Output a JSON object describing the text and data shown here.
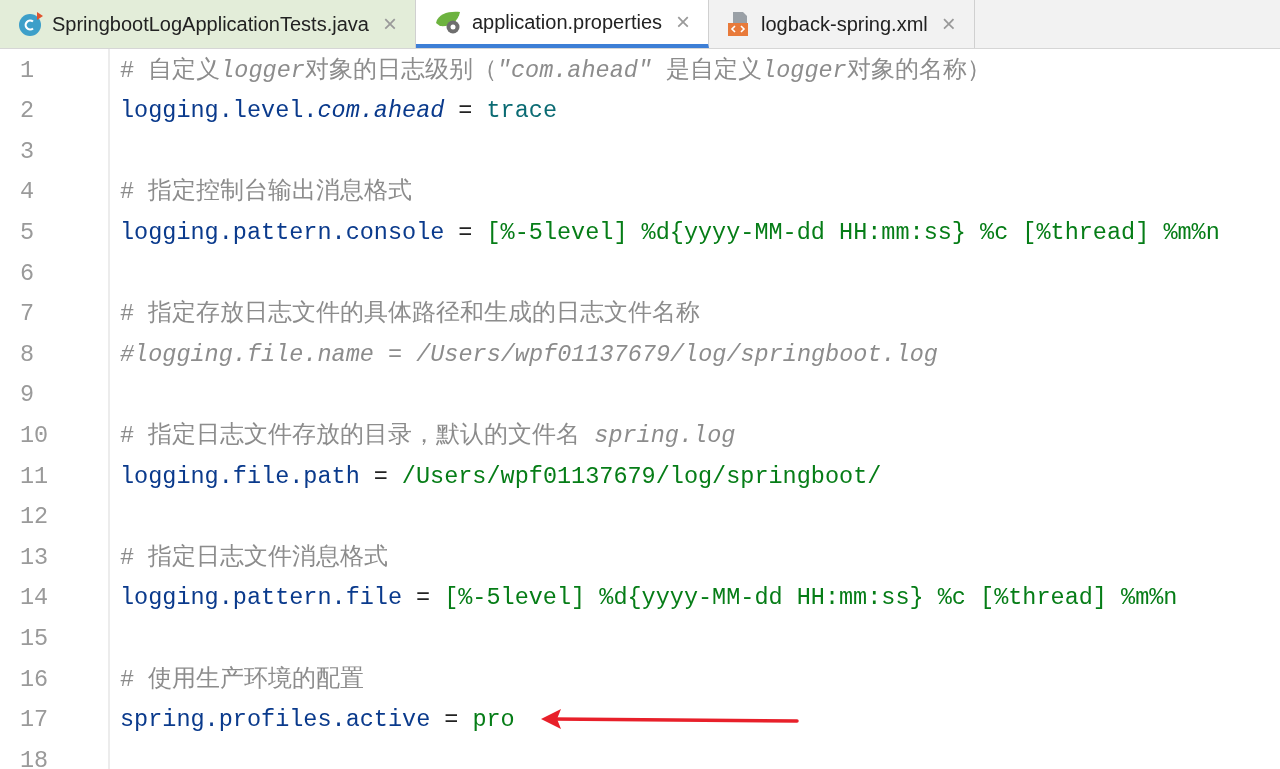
{
  "tabs": [
    {
      "label": "SpringbootLogApplicationTests.java",
      "kind": "java",
      "selected": false,
      "close": "×"
    },
    {
      "label": "application.properties",
      "kind": "properties",
      "selected": true,
      "close": "×"
    },
    {
      "label": "logback-spring.xml",
      "kind": "xml",
      "selected": false,
      "close": "×"
    }
  ],
  "lines": [
    {
      "number": "1",
      "kind": "comment",
      "parts": [
        {
          "text": "# 自定义",
          "italic": false
        },
        {
          "text": "logger",
          "italic": true
        },
        {
          "text": "对象的日志级别（",
          "italic": false
        },
        {
          "text": "\"com.ahead\"",
          "italic": true
        },
        {
          "text": " 是自定义",
          "italic": false
        },
        {
          "text": "logger",
          "italic": true
        },
        {
          "text": "对象的名称）",
          "italic": false
        }
      ]
    },
    {
      "number": "2",
      "kind": "property",
      "key": "logging.level.*com.ahead*",
      "sep": "=",
      "value": {
        "text": "trace",
        "kind": "constant"
      }
    },
    {
      "number": "3",
      "kind": "blank"
    },
    {
      "number": "4",
      "kind": "comment",
      "parts": [
        {
          "text": "# 指定控制台输出消息格式",
          "italic": false
        }
      ]
    },
    {
      "number": "5",
      "kind": "property",
      "key": "logging.pattern.console",
      "sep": "=",
      "value": {
        "text": "[%-5level] %d{yyyy-MM-dd HH:mm:ss} %c [%thread] %m%n",
        "kind": "string"
      }
    },
    {
      "number": "6",
      "kind": "blank"
    },
    {
      "number": "7",
      "kind": "comment",
      "parts": [
        {
          "text": "# 指定存放日志文件的具体路径和生成的日志文件名称",
          "italic": false
        }
      ]
    },
    {
      "number": "8",
      "kind": "disabled_code",
      "text": "#logging.file.name = /Users/wpf01137679/log/springboot.log"
    },
    {
      "number": "9",
      "kind": "blank"
    },
    {
      "number": "10",
      "kind": "comment",
      "parts": [
        {
          "text": "# 指定日志文件存放的目录，默认的文件名 ",
          "italic": false
        },
        {
          "text": "spring.log",
          "italic": true
        }
      ]
    },
    {
      "number": "11",
      "kind": "property",
      "key": "logging.file.path",
      "sep": "=",
      "value": {
        "text": "/Users/wpf01137679/log/springboot/",
        "kind": "string"
      }
    },
    {
      "number": "12",
      "kind": "blank"
    },
    {
      "number": "13",
      "kind": "comment",
      "parts": [
        {
          "text": "# 指定日志文件消息格式",
          "italic": false
        }
      ]
    },
    {
      "number": "14",
      "kind": "property",
      "key": "logging.pattern.file",
      "sep": "=",
      "value": {
        "text": "[%-5level] %d{yyyy-MM-dd HH:mm:ss} %c [%thread] %m%n",
        "kind": "string"
      }
    },
    {
      "number": "15",
      "kind": "blank"
    },
    {
      "number": "16",
      "kind": "comment",
      "parts": [
        {
          "text": "# 使用生产环境的配置",
          "italic": false
        }
      ]
    },
    {
      "number": "17",
      "kind": "property",
      "key": "spring.profiles.active",
      "sep": "=",
      "value": {
        "text": "pro",
        "kind": "string"
      },
      "arrow": true
    },
    {
      "number": "18",
      "kind": "blank"
    }
  ]
}
